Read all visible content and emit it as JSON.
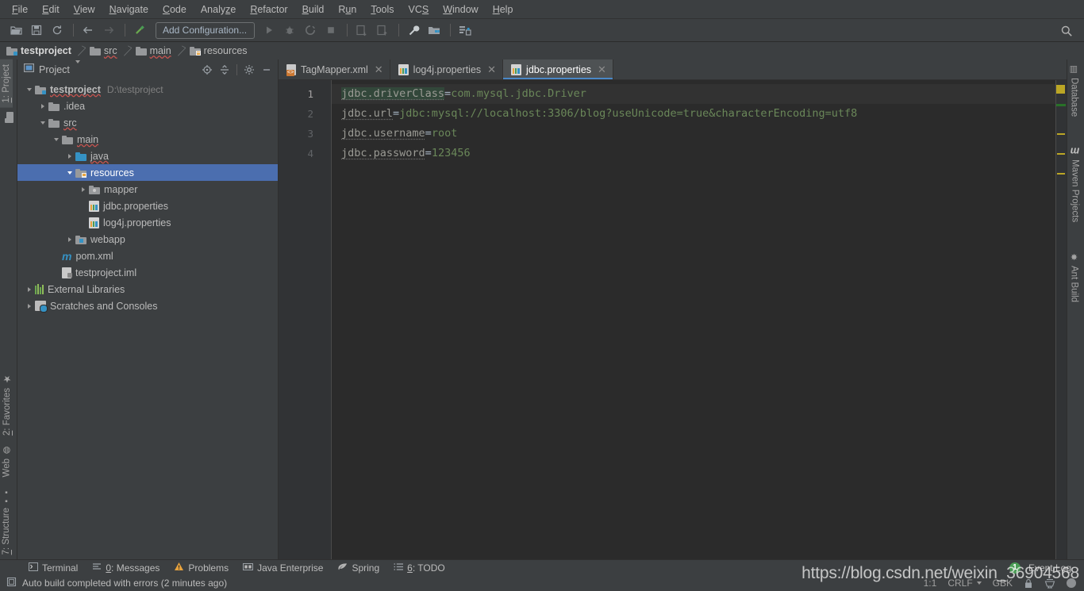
{
  "menu": {
    "items": [
      {
        "label": "File",
        "mnemonic": "F"
      },
      {
        "label": "Edit",
        "mnemonic": "E"
      },
      {
        "label": "View",
        "mnemonic": "V"
      },
      {
        "label": "Navigate",
        "mnemonic": "N"
      },
      {
        "label": "Code",
        "mnemonic": "C"
      },
      {
        "label": "Analyze",
        "mnemonic": "z"
      },
      {
        "label": "Refactor",
        "mnemonic": "R"
      },
      {
        "label": "Build",
        "mnemonic": "B"
      },
      {
        "label": "Run",
        "mnemonic": "u"
      },
      {
        "label": "Tools",
        "mnemonic": "T"
      },
      {
        "label": "VCS",
        "mnemonic": "S"
      },
      {
        "label": "Window",
        "mnemonic": "W"
      },
      {
        "label": "Help",
        "mnemonic": "H"
      }
    ]
  },
  "toolbar": {
    "run_config_label": "Add Configuration...",
    "icons": [
      "open-project-icon",
      "save-all-icon",
      "sync-icon",
      "navigate-back-icon",
      "navigate-forward-icon",
      "build-hammer-icon",
      "run-icon",
      "debug-icon",
      "run-with-coverage-icon",
      "stop-icon",
      "update-project-icon",
      "commit-icon",
      "settings-wrench-icon",
      "project-structure-icon",
      "sdk-manager-icon"
    ],
    "search_icon": "search-icon"
  },
  "breadcrumb": {
    "items": [
      {
        "label": "testproject",
        "icon": "module-folder-icon",
        "error": false
      },
      {
        "label": "src",
        "icon": "folder-icon",
        "error": true
      },
      {
        "label": "main",
        "icon": "folder-icon",
        "error": true
      },
      {
        "label": "resources",
        "icon": "resources-folder-icon",
        "error": false
      }
    ]
  },
  "left_stripe": {
    "top": [
      {
        "label": "1: Project",
        "mnemonic": "1",
        "active": true,
        "icon": "project-icon"
      },
      {
        "label": "",
        "icon": "folder-icon",
        "active": false
      }
    ],
    "bottom": [
      {
        "label": "2: Favorites",
        "mnemonic": "2",
        "icon": "star-icon"
      },
      {
        "label": "Web",
        "icon": "web-globe-icon"
      },
      {
        "label": "7: Structure",
        "mnemonic": "7",
        "icon": "structure-icon"
      }
    ]
  },
  "right_stripe": {
    "items": [
      {
        "label": "Database",
        "icon": "database-icon"
      },
      {
        "label": "Maven Projects",
        "icon": "maven-m-icon"
      },
      {
        "label": "Ant Build",
        "icon": "ant-icon"
      }
    ]
  },
  "project_panel": {
    "title": "Project",
    "dropdown_icon": "chevron-down-icon",
    "header_icons": [
      "locate-target-icon",
      "collapse-all-icon",
      "gear-icon",
      "minimize-icon"
    ],
    "tree": [
      {
        "indent": 0,
        "twisty": "down",
        "icon": "module-folder-icon",
        "label": "testproject",
        "bold": true,
        "path": "D:\\testproject",
        "selected": false
      },
      {
        "indent": 1,
        "twisty": "right",
        "icon": "folder-icon",
        "label": ".idea",
        "bold": false,
        "path": "",
        "selected": false
      },
      {
        "indent": 1,
        "twisty": "down",
        "icon": "folder-icon",
        "label": "src",
        "bold": false,
        "path": "",
        "selected": false
      },
      {
        "indent": 2,
        "twisty": "down",
        "icon": "folder-icon",
        "label": "main",
        "bold": false,
        "path": "",
        "selected": false
      },
      {
        "indent": 3,
        "twisty": "right",
        "icon": "sources-folder-icon",
        "label": "java",
        "bold": false,
        "path": "",
        "selected": false
      },
      {
        "indent": 3,
        "twisty": "down",
        "icon": "resources-folder-icon",
        "label": "resources",
        "bold": false,
        "path": "",
        "selected": true
      },
      {
        "indent": 4,
        "twisty": "right",
        "icon": "package-folder-icon",
        "label": "mapper",
        "bold": false,
        "path": "",
        "selected": false
      },
      {
        "indent": 4,
        "twisty": "none",
        "icon": "properties-file-icon",
        "label": "jdbc.properties",
        "bold": false,
        "path": "",
        "selected": false
      },
      {
        "indent": 4,
        "twisty": "none",
        "icon": "properties-file-icon",
        "label": "log4j.properties",
        "bold": false,
        "path": "",
        "selected": false
      },
      {
        "indent": 3,
        "twisty": "right",
        "icon": "webapp-folder-icon",
        "label": "webapp",
        "bold": false,
        "path": "",
        "selected": false
      },
      {
        "indent": 2,
        "twisty": "none",
        "icon": "maven-m-icon",
        "label": "pom.xml",
        "bold": false,
        "path": "",
        "selected": false
      },
      {
        "indent": 2,
        "twisty": "none",
        "icon": "iml-file-icon",
        "label": "testproject.iml",
        "bold": false,
        "path": "",
        "selected": false
      },
      {
        "indent": 0,
        "twisty": "right",
        "icon": "external-libraries-icon",
        "label": "External Libraries",
        "bold": false,
        "path": "",
        "selected": false
      },
      {
        "indent": 0,
        "twisty": "right",
        "icon": "scratches-icon",
        "label": "Scratches and Consoles",
        "bold": false,
        "path": "",
        "selected": false
      }
    ]
  },
  "editor": {
    "tabs": [
      {
        "label": "TagMapper.xml",
        "icon": "xml-file-icon",
        "active": false,
        "close_icon": "close-icon"
      },
      {
        "label": "log4j.properties",
        "icon": "properties-file-icon",
        "active": false,
        "close_icon": "close-icon"
      },
      {
        "label": "jdbc.properties",
        "icon": "properties-file-icon",
        "active": true,
        "close_icon": "close-icon"
      }
    ],
    "lines": [
      {
        "number": "1",
        "key": "jdbc.driverClass",
        "sep": "=",
        "value": "com.mysql.jdbc.Driver",
        "caret": true,
        "key_highlight": true
      },
      {
        "number": "2",
        "key": "jdbc.url",
        "sep": "=",
        "value": "jdbc:mysql://localhost:3306/blog?useUnicode=true&characterEncoding=utf8",
        "caret": false,
        "key_highlight": false
      },
      {
        "number": "3",
        "key": "jdbc.username",
        "sep": "=",
        "value": "root",
        "caret": false,
        "key_highlight": false
      },
      {
        "number": "4",
        "key": "jdbc.password",
        "sep": "=",
        "value": "123456",
        "caret": false,
        "key_highlight": false
      }
    ],
    "markers": {
      "warning_box_color": "#bba625",
      "green_stripe_color": "#287128"
    }
  },
  "bottom_bar": {
    "items": [
      {
        "label": "Terminal",
        "mnemonic": "",
        "icon": "terminal-icon"
      },
      {
        "label": "0: Messages",
        "mnemonic": "0",
        "icon": "messages-icon"
      },
      {
        "label": "Problems",
        "mnemonic": "",
        "icon": "warning-triangle-icon"
      },
      {
        "label": "Java Enterprise",
        "mnemonic": "",
        "icon": "java-enterprise-icon"
      },
      {
        "label": "Spring",
        "mnemonic": "",
        "icon": "spring-leaf-icon"
      },
      {
        "label": "6: TODO",
        "mnemonic": "6",
        "icon": "todo-icon"
      }
    ],
    "event_log": {
      "label": "Event Log",
      "badge": "1",
      "badge_color": "#499c54"
    }
  },
  "statusbar": {
    "message": "Auto build completed with errors (2 minutes ago)",
    "message_icon": "build-status-icon",
    "caret_position": "1:1",
    "line_separator": "CRLF",
    "encoding": "GBK",
    "lock_icon": "read-only-icon",
    "inspection_icon": "inspection-level-icon",
    "memory_icon": "background-tasks-icon"
  },
  "watermark": {
    "text": "https://blog.csdn.net/weixin_36904568"
  },
  "colors": {
    "selection_blue": "#4b6eaf",
    "editor_bg": "#2b2b2b",
    "panel_bg": "#3c3f41",
    "value_green": "#6a8759",
    "tab_accent": "#4a88c7"
  }
}
